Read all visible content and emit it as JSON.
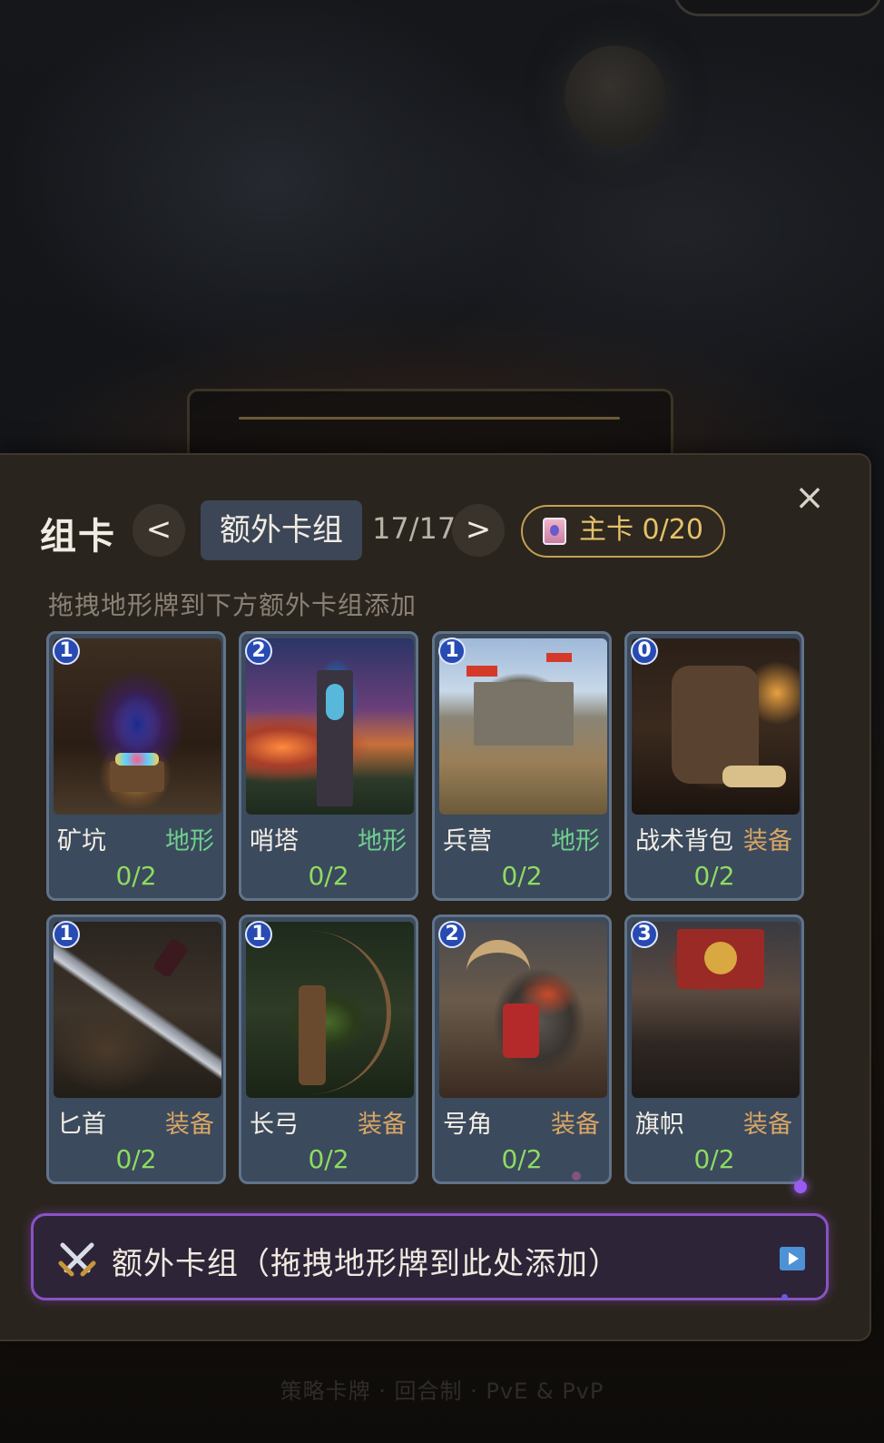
{
  "panel": {
    "title": "组卡",
    "prev_label": "<",
    "next_label": ">",
    "active_tab": "额外卡组",
    "count": "17/17",
    "main_deck": "主卡 0/20",
    "hint": "拖拽地形牌到下方额外卡组添加",
    "close_label": "×"
  },
  "cards": [
    {
      "cost": "1",
      "name": "矿坑",
      "type": "地形",
      "qty": "0/2"
    },
    {
      "cost": "2",
      "name": "哨塔",
      "type": "地形",
      "qty": "0/2"
    },
    {
      "cost": "1",
      "name": "兵营",
      "type": "地形",
      "qty": "0/2"
    },
    {
      "cost": "0",
      "name": "战术背包",
      "type": "装备",
      "qty": "0/2"
    },
    {
      "cost": "1",
      "name": "匕首",
      "type": "装备",
      "qty": "0/2"
    },
    {
      "cost": "1",
      "name": "长弓",
      "type": "装备",
      "qty": "0/2"
    },
    {
      "cost": "2",
      "name": "号角",
      "type": "装备",
      "qty": "0/2"
    },
    {
      "cost": "3",
      "name": "旗帜",
      "type": "装备",
      "qty": "0/2"
    }
  ],
  "dropzone": {
    "label": "额外卡组（拖拽地形牌到此处添加）"
  },
  "footer": "策略卡牌 · 回合制 · PvE & PvP",
  "colors": {
    "terrain": "#6fcf8f",
    "equipment": "#d9a565",
    "quantity": "#8ddc62",
    "accent_gold": "#c4a052",
    "dropzone_border": "#8a52c6"
  }
}
